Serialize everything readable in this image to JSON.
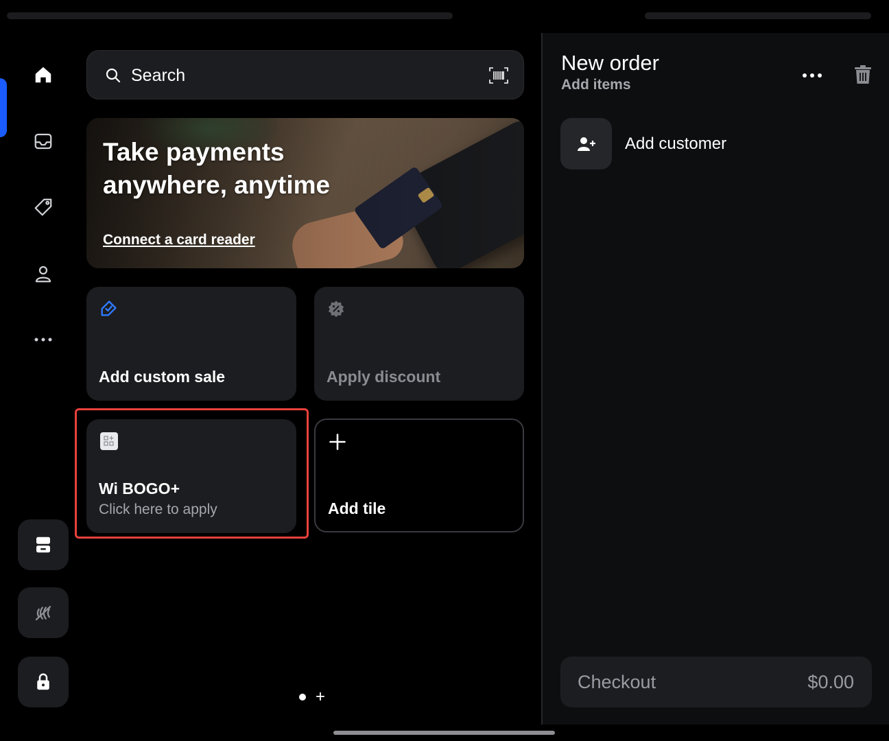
{
  "colors": {
    "accent": "#1a5cff",
    "highlight": "#e8413b",
    "panel": "#1c1d20",
    "muted_text": "#a5a7ad"
  },
  "rail": {
    "items": [
      {
        "icon": "home-icon",
        "active": true
      },
      {
        "icon": "inbox-icon",
        "active": false
      },
      {
        "icon": "tag-icon",
        "active": false
      },
      {
        "icon": "person-icon",
        "active": false
      },
      {
        "icon": "more-horizontal-icon",
        "active": false
      }
    ],
    "bottom": [
      {
        "icon": "register-icon"
      },
      {
        "icon": "contactless-off-icon"
      },
      {
        "icon": "lock-icon"
      }
    ]
  },
  "search": {
    "placeholder": "Search",
    "scan_icon": "barcode-scan-icon"
  },
  "banner": {
    "title_line1": "Take payments",
    "title_line2": "anywhere, anytime",
    "link": "Connect a card reader"
  },
  "tiles": {
    "custom_sale": {
      "label": "Add custom sale",
      "icon": "tag-check-icon",
      "icon_color": "#2f7bff"
    },
    "discount": {
      "label": "Apply discount",
      "icon": "discount-badge-icon",
      "disabled": true
    },
    "bogo": {
      "label": "Wi BOGO+",
      "sub": "Click here to apply",
      "icon": "app-tile-icon"
    },
    "add_tile": {
      "label": "Add tile",
      "icon": "plus-icon"
    }
  },
  "pager": {
    "pages": 1,
    "current": 1
  },
  "order": {
    "title": "New order",
    "subtitle": "Add items",
    "add_customer": "Add customer",
    "checkout_label": "Checkout",
    "checkout_total": "$0.00"
  }
}
